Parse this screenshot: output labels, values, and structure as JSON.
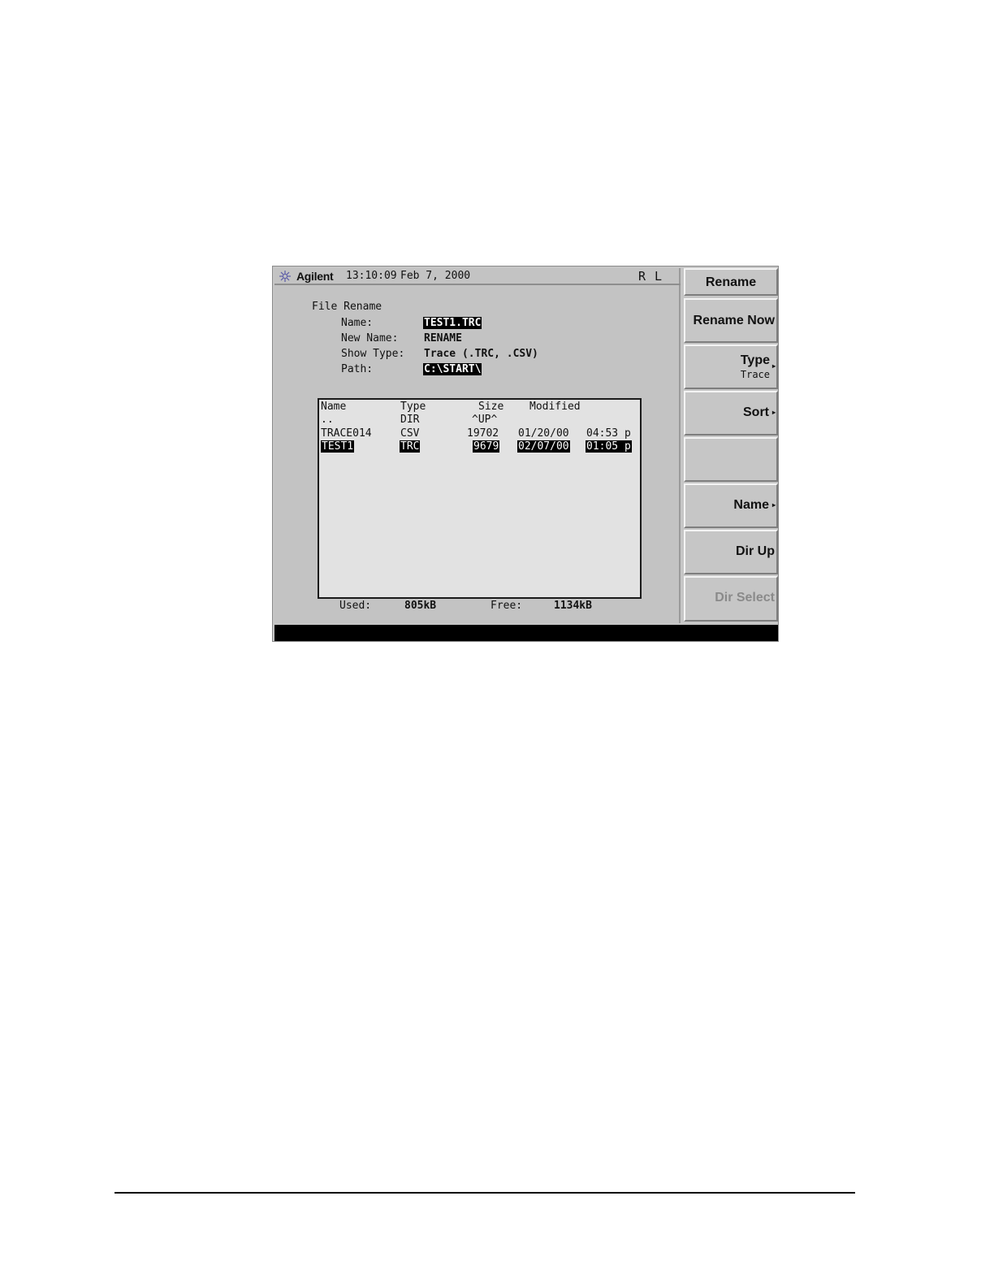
{
  "header": {
    "brand": "Agilent",
    "time": "13:10:09",
    "date": "Feb 7, 2000",
    "status_indicator": "R L",
    "logo_icon": "agilent-spark-icon"
  },
  "form": {
    "title": "File Rename",
    "name_label": "Name:",
    "name_value": "TEST1.TRC",
    "new_name_label": "New Name:",
    "new_name_value": "RENAME",
    "show_type_label": "Show Type:",
    "show_type_value": "Trace (.TRC, .CSV)",
    "path_label": "Path:",
    "path_value": "C:\\START\\"
  },
  "file_list": {
    "headers": {
      "name": "Name",
      "type": "Type",
      "size": "Size",
      "modified": "Modified"
    },
    "rows": [
      {
        "name": "..",
        "type": "DIR",
        "size": "^UP^",
        "date": "",
        "time": ""
      },
      {
        "name": "TRACE014",
        "type": "CSV",
        "size": "19702",
        "date": "01/20/00",
        "time": "04:53 p"
      },
      {
        "name": "TEST1",
        "type": "TRC",
        "size": "9679",
        "date": "02/07/00",
        "time": "01:05 p"
      }
    ],
    "selected_row": 2
  },
  "storage": {
    "used_label": "Used:",
    "used_value": "805kB",
    "free_label": "Free:",
    "free_value": "1134kB"
  },
  "softkeys": {
    "menu_title": "Rename",
    "rename_now": "Rename Now",
    "type": "Type",
    "type_sub": "Trace",
    "sort": "Sort",
    "name": "Name",
    "dir_up": "Dir Up",
    "dir_select": "Dir Select"
  },
  "colors": {
    "screen_bg": "#c3c3c3",
    "list_bg": "#e2e2e2",
    "highlight": "#000000",
    "disabled_text": "#8a8a8a",
    "logo": "#5a5aa8"
  }
}
